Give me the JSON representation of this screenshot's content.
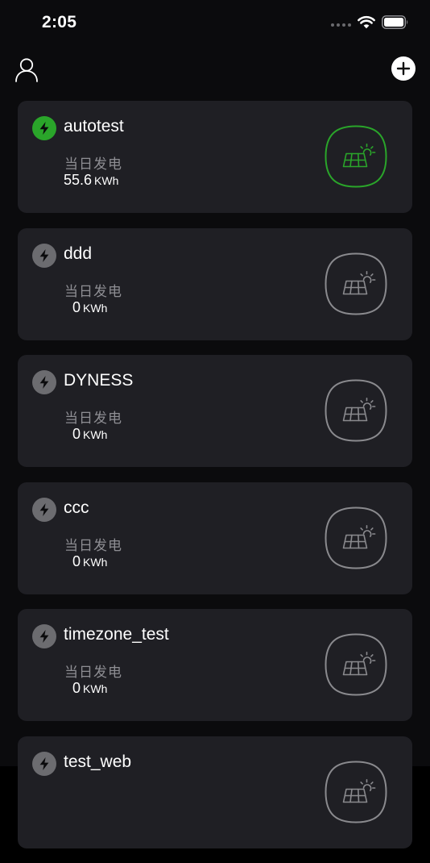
{
  "status_bar": {
    "time": "2:05"
  },
  "header": {
    "profile_icon": "person-icon",
    "add_icon": "plus-circle-icon"
  },
  "colors": {
    "online": "#2aa52a",
    "offline": "#6c6c70",
    "card_bg": "#1f1f24",
    "page_bg": "#0b0b0d"
  },
  "plants": [
    {
      "name": "autotest",
      "label": "当日发电",
      "value": "55.6",
      "unit": "KWh",
      "status": "online",
      "badge_icon": "solar-panel-icon"
    },
    {
      "name": "ddd",
      "label": "当日发电",
      "value": "0",
      "unit": "KWh",
      "status": "offline",
      "badge_icon": "solar-panel-icon"
    },
    {
      "name": "DYNESS",
      "label": "当日发电",
      "value": "0",
      "unit": "KWh",
      "status": "offline",
      "badge_icon": "solar-panel-icon"
    },
    {
      "name": "ccc",
      "label": "当日发电",
      "value": "0",
      "unit": "KWh",
      "status": "offline",
      "badge_icon": "solar-panel-icon"
    },
    {
      "name": "timezone_test",
      "label": "当日发电",
      "value": "0",
      "unit": "KWh",
      "status": "offline",
      "badge_icon": "solar-panel-icon"
    },
    {
      "name": "test_web",
      "label": "",
      "value": "",
      "unit": "",
      "status": "offline",
      "badge_icon": "solar-panel-icon"
    }
  ]
}
